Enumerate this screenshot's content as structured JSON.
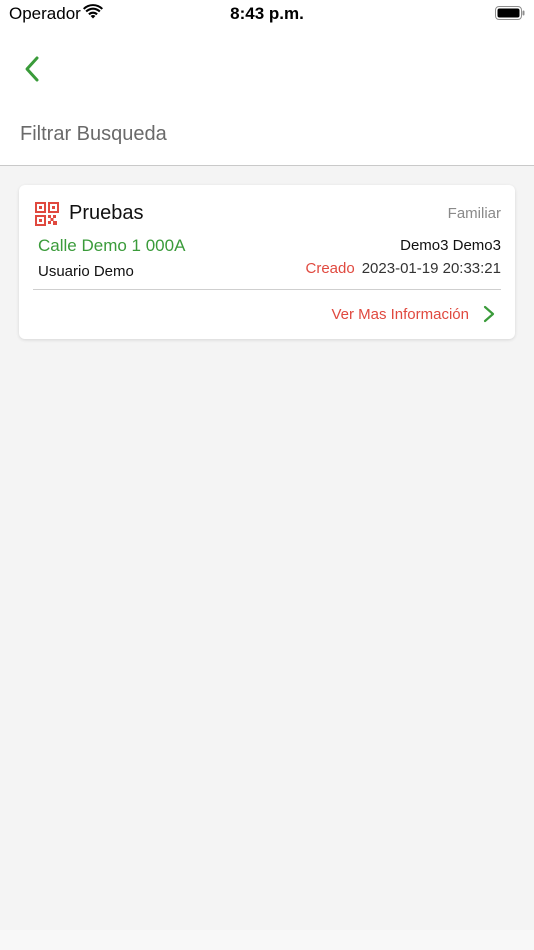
{
  "status_bar": {
    "carrier": "Operador",
    "time": "8:43 p.m."
  },
  "nav": {
    "back_icon": "chevron-left-icon"
  },
  "filter": {
    "label": "Filtrar Busqueda"
  },
  "card": {
    "icon": "qr-code-icon",
    "title": "Pruebas",
    "type": "Familiar",
    "address": "Calle Demo 1 000A",
    "names": "Demo3 Demo3",
    "user": "Usuario Demo",
    "created_label": "Creado",
    "created_date": "2023-01-19 20:33:21",
    "more_info_label": "Ver Mas Información"
  },
  "colors": {
    "accent_green": "#3a9b3a",
    "accent_red": "#e0493f",
    "background": "#f4f4f4"
  }
}
